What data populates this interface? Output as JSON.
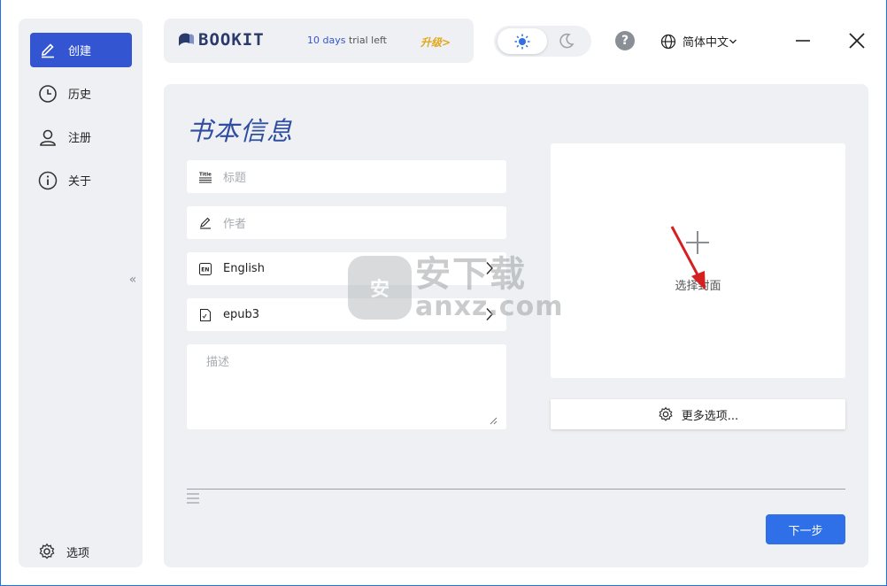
{
  "sidebar": {
    "items": [
      {
        "label": "创建",
        "icon": "pen-icon",
        "active": true
      },
      {
        "label": "历史",
        "icon": "clock-icon",
        "active": false
      },
      {
        "label": "注册",
        "icon": "user-icon",
        "active": false
      },
      {
        "label": "关于",
        "icon": "info-icon",
        "active": false
      }
    ],
    "settings_label": "选项",
    "collapse_glyph": "«"
  },
  "brand": {
    "logo_text": "BOOKIT",
    "trial_days": "10 days",
    "trial_suffix": " trial left",
    "upgrade_label": "升级>"
  },
  "header": {
    "help_glyph": "?",
    "language": "简体中文"
  },
  "form": {
    "title": "书本信息",
    "title_field_placeholder": "标题",
    "author_field_placeholder": "作者",
    "language_value": "English",
    "format_value": "epub3",
    "description_placeholder": "描述"
  },
  "cover": {
    "label": "选择封面",
    "more_options_label": "更多选项..."
  },
  "footer": {
    "next_label": "下一步"
  },
  "watermark": {
    "shield_char": "安",
    "cn": "安下载",
    "en": "anxz.com"
  },
  "colors": {
    "accent": "#3355d1",
    "primary_button": "#2f6fe8",
    "panel_bg": "#eef0f3",
    "upgrade": "#e0a81e",
    "title": "#2f4ea0"
  }
}
